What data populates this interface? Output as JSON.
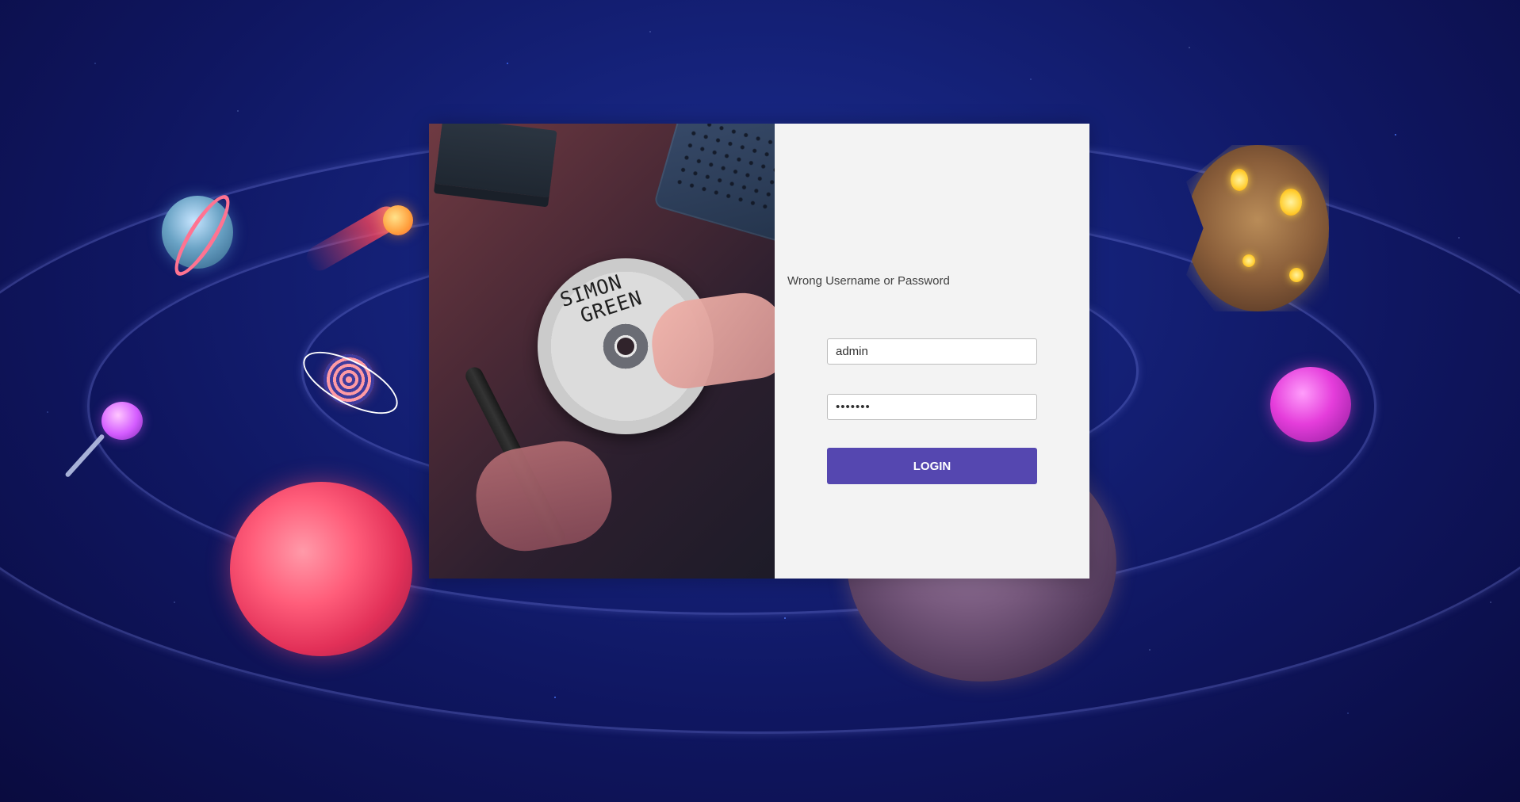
{
  "login": {
    "error_message": "Wrong Username or Password",
    "username_value": "admin",
    "password_value": "•••••••",
    "button_label": "LOGIN"
  },
  "photo": {
    "cd_text_line1": "SIMON",
    "cd_text_line2": "GREEN"
  },
  "colors": {
    "background": "#15227a",
    "form_panel": "#f3f3f3",
    "button": "#5547b0",
    "button_text": "#ffffff"
  },
  "icons": [
    "planet-icon",
    "comet-icon",
    "moon-icon",
    "lollipop-icon",
    "target-icon"
  ]
}
